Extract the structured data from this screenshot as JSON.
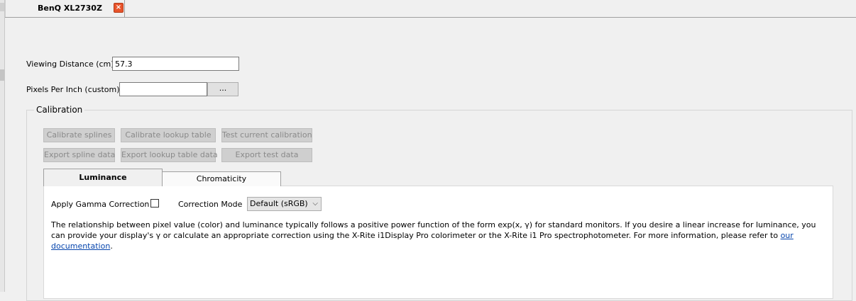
{
  "tab": {
    "title": "BenQ XL2730Z",
    "close_glyph": "×"
  },
  "viewing_distance": {
    "label": "Viewing Distance (cm)",
    "value": "57.3"
  },
  "ppi": {
    "label": "Pixels Per Inch (custom)",
    "value": "",
    "browse_label": "..."
  },
  "calibration": {
    "title": "Calibration",
    "calibrate_splines": "Calibrate splines",
    "calibrate_lookup": "Calibrate lookup table",
    "test_calibration": "Test current calibration",
    "export_spline": "Export spline data",
    "export_lookup": "Export lookup table data",
    "export_test": "Export test data"
  },
  "subtabs": {
    "luminance": "Luminance",
    "chromaticity": "Chromaticity"
  },
  "luminance": {
    "gamma_label": "Apply Gamma Correction",
    "gamma_checked": false,
    "mode_label": "Correction Mode",
    "mode_value": "Default (sRGB)",
    "description": "The relationship between pixel value (color) and luminance typically follows a positive power function of the form exp(x, γ) for standard monitors. If you desire a linear increase for luminance, you can provide your display's γ or calculate an appropriate correction using the X-Rite i1Display Pro colorimeter or the X-Rite i1 Pro spectrophotometer. For more information, please refer to ",
    "link_text": "our documentation",
    "tail": "."
  }
}
